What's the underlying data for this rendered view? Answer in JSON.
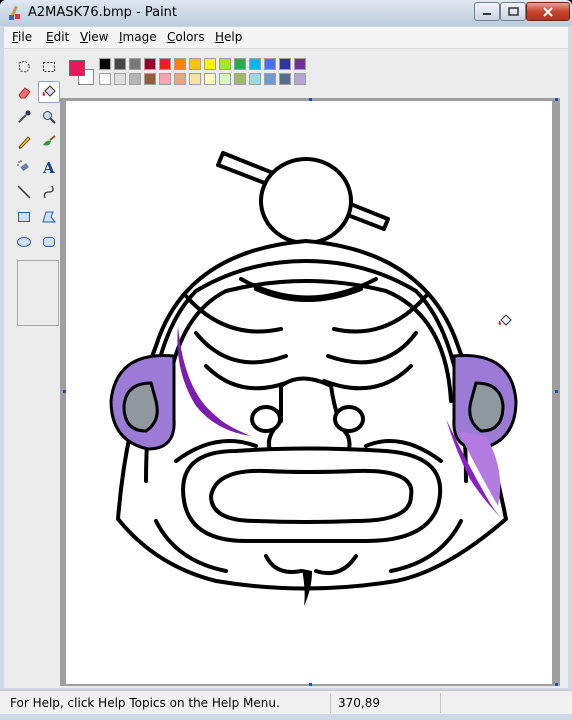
{
  "window": {
    "title": "A2MASK76.bmp - Paint",
    "accent_color": "#c8452b"
  },
  "menu": {
    "items": [
      {
        "label": "File"
      },
      {
        "label": "Edit"
      },
      {
        "label": "View"
      },
      {
        "label": "Image"
      },
      {
        "label": "Colors"
      },
      {
        "label": "Help"
      }
    ]
  },
  "toolbox": {
    "tools": [
      {
        "name": "free-form-select-icon"
      },
      {
        "name": "select-icon"
      },
      {
        "name": "eraser-icon"
      },
      {
        "name": "fill-with-color-icon",
        "selected": true
      },
      {
        "name": "pick-color-icon"
      },
      {
        "name": "magnifier-icon"
      },
      {
        "name": "pencil-icon"
      },
      {
        "name": "brush-icon"
      },
      {
        "name": "airbrush-icon"
      },
      {
        "name": "text-icon"
      },
      {
        "name": "line-icon"
      },
      {
        "name": "curve-icon"
      },
      {
        "name": "rectangle-icon"
      },
      {
        "name": "polygon-icon"
      },
      {
        "name": "ellipse-icon"
      },
      {
        "name": "rounded-rectangle-icon"
      }
    ]
  },
  "palette": {
    "foreground": "#e8185a",
    "background": "#ffffff",
    "top_row": [
      "#000000",
      "#464646",
      "#787878",
      "#990030",
      "#ed1c24",
      "#ff7e00",
      "#ffc20e",
      "#fff200",
      "#a8e61d",
      "#22b14c",
      "#00b7ef",
      "#4d6df3",
      "#2f3699",
      "#6f3198"
    ],
    "bottom_row": [
      "#ffffff",
      "#dcdcdc",
      "#b4b4b4",
      "#9c5a3c",
      "#ffa3b1",
      "#e5aa7a",
      "#f5e49c",
      "#fff9bd",
      "#d3f9bc",
      "#9dbb61",
      "#99d9ea",
      "#709ad1",
      "#546d8e",
      "#b5a5d5"
    ]
  },
  "status": {
    "help_text": "For Help, click Help Topics on the Help Menu.",
    "coordinates": "370,89"
  }
}
